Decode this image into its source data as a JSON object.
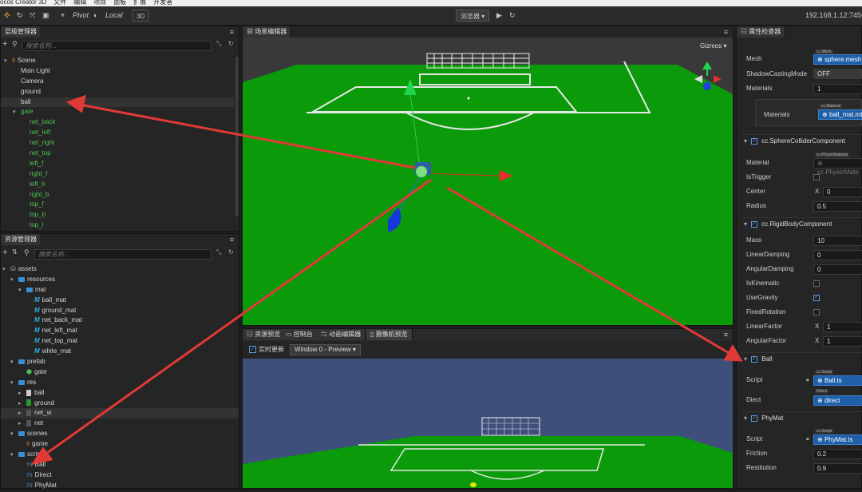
{
  "menubar": {
    "items": [
      "ocos Creator 3D",
      "文件",
      "编辑",
      "项目",
      "面板",
      "扩展",
      "开发者"
    ]
  },
  "toolbar": {
    "pivot": "Pivot",
    "local": "Local",
    "mode3d": "3D",
    "browser": "浏览器 ▾",
    "ip": "192.168.1.12:7456"
  },
  "hierarchy": {
    "tab": "层级管理器",
    "search_placeholder": "搜索名称...",
    "nodes": [
      {
        "label": "Scene",
        "level": 0,
        "kind": "scene"
      },
      {
        "label": "Main Light",
        "level": 1
      },
      {
        "label": "Camera",
        "level": 1
      },
      {
        "label": "ground",
        "level": 1
      },
      {
        "label": "ball",
        "level": 1,
        "selected": true
      },
      {
        "label": "gate",
        "level": 1,
        "kind": "prefab"
      },
      {
        "label": "net_back",
        "level": 2,
        "kind": "prefab"
      },
      {
        "label": "net_left",
        "level": 2,
        "kind": "prefab"
      },
      {
        "label": "net_right",
        "level": 2,
        "kind": "prefab"
      },
      {
        "label": "net_top",
        "level": 2,
        "kind": "prefab"
      },
      {
        "label": "left_f",
        "level": 2,
        "kind": "prefab"
      },
      {
        "label": "right_f",
        "level": 2,
        "kind": "prefab"
      },
      {
        "label": "left_b",
        "level": 2,
        "kind": "prefab"
      },
      {
        "label": "right_b",
        "level": 2,
        "kind": "prefab"
      },
      {
        "label": "top_f",
        "level": 2,
        "kind": "prefab"
      },
      {
        "label": "top_b",
        "level": 2,
        "kind": "prefab"
      },
      {
        "label": "top_l",
        "level": 2,
        "kind": "prefab"
      }
    ]
  },
  "assets": {
    "tab": "资源管理器",
    "search_placeholder": "搜索名称...",
    "nodes": [
      {
        "label": "assets",
        "level": 0,
        "kind": "db"
      },
      {
        "label": "resources",
        "level": 1,
        "kind": "folder"
      },
      {
        "label": "mat",
        "level": 2,
        "kind": "folder"
      },
      {
        "label": "ball_mat",
        "level": 3,
        "kind": "mat"
      },
      {
        "label": "ground_mat",
        "level": 3,
        "kind": "mat"
      },
      {
        "label": "net_back_mat",
        "level": 3,
        "kind": "mat"
      },
      {
        "label": "net_left_mat",
        "level": 3,
        "kind": "mat"
      },
      {
        "label": "net_top_mat",
        "level": 3,
        "kind": "mat"
      },
      {
        "label": "white_mat",
        "level": 3,
        "kind": "mat"
      },
      {
        "label": "prefab",
        "level": 1,
        "kind": "folder"
      },
      {
        "label": "gate",
        "level": 2,
        "kind": "prefabasset"
      },
      {
        "label": "res",
        "level": 1,
        "kind": "folder"
      },
      {
        "label": "ball",
        "level": 2,
        "kind": "mesh"
      },
      {
        "label": "ground",
        "level": 2,
        "kind": "mesh"
      },
      {
        "label": "net_w",
        "level": 2,
        "kind": "mesh",
        "selected": true
      },
      {
        "label": "net",
        "level": 2,
        "kind": "mesh"
      },
      {
        "label": "scenes",
        "level": 1,
        "kind": "folder"
      },
      {
        "label": "game",
        "level": 2,
        "kind": "scene"
      },
      {
        "label": "scripts",
        "level": 1,
        "kind": "folder"
      },
      {
        "label": "Ball",
        "level": 2,
        "kind": "ts"
      },
      {
        "label": "Direct",
        "level": 2,
        "kind": "ts"
      },
      {
        "label": "PhyMat",
        "level": 2,
        "kind": "ts"
      }
    ]
  },
  "scene": {
    "tab": "场景编辑器",
    "gizmos": "Gizmos ▾"
  },
  "preview": {
    "tabs": [
      "资源预览",
      "控制台",
      "动画编辑器",
      "摄像机预览"
    ],
    "realtime": "实时更新",
    "window": "Window 0 - Preview"
  },
  "inspector": {
    "tab": "属性检查器",
    "mesh_label": "Mesh",
    "mesh_type": "cc.Mesh",
    "mesh_value": "sphere.mesh",
    "shadow_label": "ShadowCastingMode",
    "shadow_value": "OFF",
    "materials_label": "Materials",
    "materials_count": "1",
    "materials_sub": "Materials",
    "material_type": "cc.Material",
    "material_value": "ball_mat.mtl",
    "sphere_collider": "cc.SphereColliderComponent",
    "material_label": "Material",
    "physmat_type": "cc.PhysicMaterial",
    "physmat_value": "cc.PhysicMate",
    "istrigger": "IsTrigger",
    "center": "Center",
    "center_x": "X",
    "center_val": "0",
    "radius": "Radius",
    "radius_val": "0.5",
    "rigidbody": "cc.RigidBodyComponent",
    "mass": "Mass",
    "mass_val": "10",
    "lindamp": "LinearDamping",
    "lindamp_val": "0",
    "angdamp": "AngularDamping",
    "angdamp_val": "0",
    "iskin": "IsKinematic",
    "usegrav": "UseGravity",
    "fixedrot": "FixedRotation",
    "linfac": "LinearFactor",
    "linfac_x": "X",
    "linfac_val": "1",
    "angfac": "AngularFactor",
    "angfac_x": "X",
    "angfac_val": "1",
    "ball_comp": "Ball",
    "script": "Script",
    "script_type": "cc.Script",
    "ball_script": "Ball.ts",
    "diect": "Diect",
    "direct_type": "Direct",
    "direct_val": "direct",
    "phymat_comp": "PhyMat",
    "script2": "Script",
    "script2_type": "cc.Script",
    "phymat_script": "PhyMat.ts",
    "friction": "Friction",
    "friction_val": "0.2",
    "restitution": "Restitution",
    "restitution_val": "0.9"
  },
  "colors": {
    "field": "#0a9a0a",
    "lines": "#e8e8e8",
    "annot_arrow": "#e03a36",
    "sky": "#3d4f7a"
  }
}
